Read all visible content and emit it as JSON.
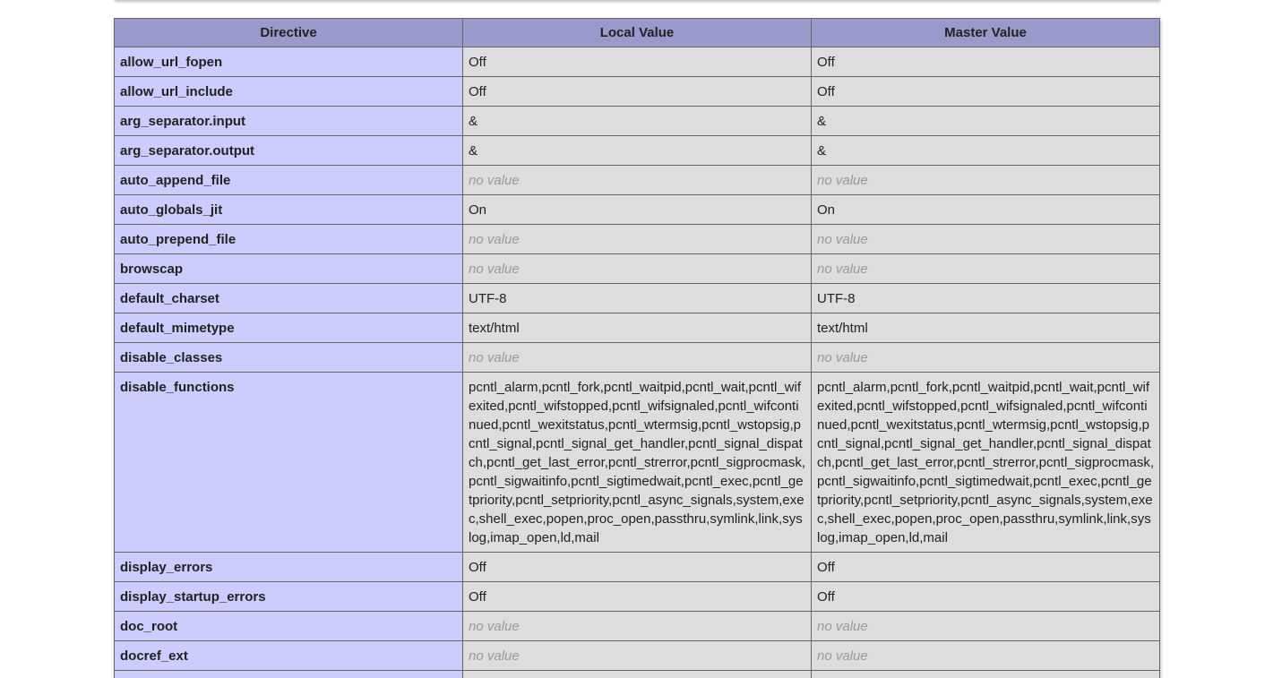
{
  "table": {
    "headers": [
      "Directive",
      "Local Value",
      "Master Value"
    ],
    "rows": [
      {
        "directive": "allow_url_fopen",
        "local": "Off",
        "master": "Off"
      },
      {
        "directive": "allow_url_include",
        "local": "Off",
        "master": "Off"
      },
      {
        "directive": "arg_separator.input",
        "local": "&",
        "master": "&"
      },
      {
        "directive": "arg_separator.output",
        "local": "&",
        "master": "&"
      },
      {
        "directive": "auto_append_file",
        "local": "no value",
        "master": "no value"
      },
      {
        "directive": "auto_globals_jit",
        "local": "On",
        "master": "On"
      },
      {
        "directive": "auto_prepend_file",
        "local": "no value",
        "master": "no value"
      },
      {
        "directive": "browscap",
        "local": "no value",
        "master": "no value"
      },
      {
        "directive": "default_charset",
        "local": "UTF-8",
        "master": "UTF-8"
      },
      {
        "directive": "default_mimetype",
        "local": "text/html",
        "master": "text/html"
      },
      {
        "directive": "disable_classes",
        "local": "no value",
        "master": "no value"
      },
      {
        "directive": "disable_functions",
        "local": "pcntl_alarm,pcntl_fork,pcntl_waitpid,pcntl_wait,pcntl_wifexited,pcntl_wifstopped,pcntl_wifsignaled,pcntl_wifcontinued,pcntl_wexitstatus,pcntl_wtermsig,pcntl_wstopsig,pcntl_signal,pcntl_signal_get_handler,pcntl_signal_dispatch,pcntl_get_last_error,pcntl_strerror,pcntl_sigprocmask,pcntl_sigwaitinfo,pcntl_sigtimedwait,pcntl_exec,pcntl_getpriority,pcntl_setpriority,pcntl_async_signals,system,exec,shell_exec,popen,proc_open,passthru,symlink,link,syslog,imap_open,ld,mail",
        "master": "pcntl_alarm,pcntl_fork,pcntl_waitpid,pcntl_wait,pcntl_wifexited,pcntl_wifstopped,pcntl_wifsignaled,pcntl_wifcontinued,pcntl_wexitstatus,pcntl_wtermsig,pcntl_wstopsig,pcntl_signal,pcntl_signal_get_handler,pcntl_signal_dispatch,pcntl_get_last_error,pcntl_strerror,pcntl_sigprocmask,pcntl_sigwaitinfo,pcntl_sigtimedwait,pcntl_exec,pcntl_getpriority,pcntl_setpriority,pcntl_async_signals,system,exec,shell_exec,popen,proc_open,passthru,symlink,link,syslog,imap_open,ld,mail"
      },
      {
        "directive": "display_errors",
        "local": "Off",
        "master": "Off"
      },
      {
        "directive": "display_startup_errors",
        "local": "Off",
        "master": "Off"
      },
      {
        "directive": "doc_root",
        "local": "no value",
        "master": "no value"
      },
      {
        "directive": "docref_ext",
        "local": "no value",
        "master": "no value"
      },
      {
        "directive": "",
        "local": "",
        "master": ""
      }
    ]
  },
  "colors": {
    "header_bg": "#9999cc",
    "directive_bg": "#ccccff",
    "value_bg": "#dddddd",
    "no_value_text": "#999999",
    "border": "#666666"
  }
}
